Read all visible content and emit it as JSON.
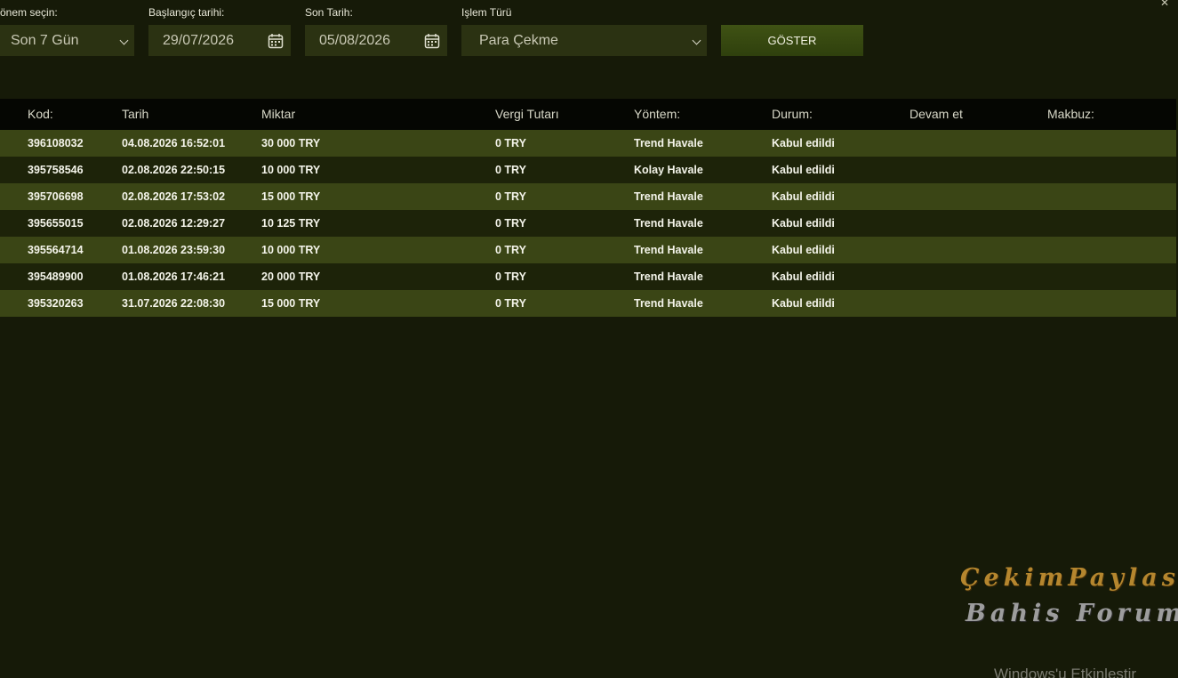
{
  "filters": {
    "period": {
      "label": "önem seçin:",
      "value": "Son 7 Gün"
    },
    "start_date": {
      "label": "Başlangıç tarihi:",
      "value": "29/07/2026"
    },
    "end_date": {
      "label": "Son Tarih:",
      "value": "05/08/2026"
    },
    "type": {
      "label": "Işlem Türü",
      "value": "Para Çekme"
    },
    "show_label": "GÖSTER"
  },
  "table": {
    "headers": {
      "kod": "Kod:",
      "tarih": "Tarih",
      "miktar": "Miktar",
      "vergi": "Vergi Tutarı",
      "yontem": "Yöntem:",
      "durum": "Durum:",
      "devam": "Devam et",
      "makbuz": "Makbuz:"
    },
    "rows": [
      {
        "kod": "396108032",
        "tarih": "04.08.2026 16:52:01",
        "miktar": "30 000 TRY",
        "vergi": "0 TRY",
        "yontem": "Trend Havale",
        "durum": "Kabul edildi"
      },
      {
        "kod": "395758546",
        "tarih": "02.08.2026 22:50:15",
        "miktar": "10 000 TRY",
        "vergi": "0 TRY",
        "yontem": "Kolay Havale",
        "durum": "Kabul edildi"
      },
      {
        "kod": "395706698",
        "tarih": "02.08.2026 17:53:02",
        "miktar": "15 000 TRY",
        "vergi": "0 TRY",
        "yontem": "Trend Havale",
        "durum": "Kabul edildi"
      },
      {
        "kod": "395655015",
        "tarih": "02.08.2026 12:29:27",
        "miktar": "10 125 TRY",
        "vergi": "0 TRY",
        "yontem": "Trend Havale",
        "durum": "Kabul edildi"
      },
      {
        "kod": "395564714",
        "tarih": "01.08.2026 23:59:30",
        "miktar": "10 000 TRY",
        "vergi": "0 TRY",
        "yontem": "Trend Havale",
        "durum": "Kabul edildi"
      },
      {
        "kod": "395489900",
        "tarih": "01.08.2026 17:46:21",
        "miktar": "20 000 TRY",
        "vergi": "0 TRY",
        "yontem": "Trend Havale",
        "durum": "Kabul edildi"
      },
      {
        "kod": "395320263",
        "tarih": "31.07.2026 22:08:30",
        "miktar": "15 000 TRY",
        "vergi": "0 TRY",
        "yontem": "Trend Havale",
        "durum": "Kabul edildi"
      }
    ]
  },
  "watermark": {
    "line1": "ÇekimPaylas",
    "line2": "Bahis Forum"
  },
  "os_notice": "Windows'u Etkinleştir",
  "colors": {
    "background": "#161a08",
    "row_highlight": "#3a4515",
    "row_dark": "#1d2309",
    "header_bg": "#050602",
    "button": "#3f5214"
  }
}
